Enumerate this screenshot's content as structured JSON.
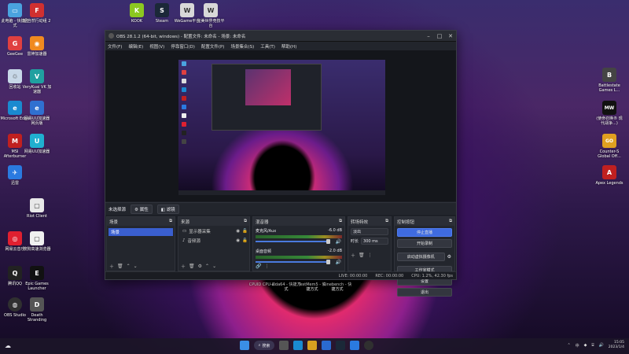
{
  "desktop": {
    "left_icons": [
      {
        "label": "此电脑 - 快捷方式",
        "color": "#4aa3df",
        "glyph": "▭"
      },
      {
        "label": "超自然行动组 2",
        "color": "#d03030",
        "glyph": "F"
      },
      {
        "label": "GeeGee",
        "color": "#e04040",
        "glyph": "G"
      },
      {
        "label": "雷神加速器",
        "color": "#f08a20",
        "glyph": "◉"
      },
      {
        "label": "回收站",
        "color": "#c8d8e8",
        "glyph": "♲"
      },
      {
        "label": "VeryKuai VK 加速器",
        "color": "#20a0a0",
        "glyph": "V"
      },
      {
        "label": "Microsoft Edge",
        "color": "#1a8ad0",
        "glyph": "e"
      },
      {
        "label": "网易UU加速器 网页版",
        "color": "#3070d0",
        "glyph": "e"
      },
      {
        "label": "MSI Afterburner",
        "color": "#c02020",
        "glyph": "M"
      },
      {
        "label": "网易UU加速器",
        "color": "#20b0d0",
        "glyph": "U"
      },
      {
        "label": "迅雷",
        "color": "#2a7ae0",
        "glyph": "✈"
      },
      {
        "label": "Riot Client",
        "color": "#e8e8e8",
        "glyph": "▢"
      },
      {
        "label": "网易云音乐",
        "color": "#e02030",
        "glyph": "◎"
      },
      {
        "label": "搜狗高速浏览器",
        "color": "#f0f0f0",
        "glyph": "▢"
      },
      {
        "label": "腾讯QQ",
        "color": "#222",
        "glyph": "Q"
      },
      {
        "label": "Epic Games Launcher",
        "color": "#111",
        "glyph": "E"
      },
      {
        "label": "OBS Studio",
        "color": "#303030",
        "glyph": "◍"
      },
      {
        "label": "Death Stranding",
        "color": "#555",
        "glyph": "D"
      }
    ],
    "top_icons": [
      {
        "label": "KOOK",
        "color": "#8cc820",
        "glyph": "K"
      },
      {
        "label": "Steam",
        "color": "#1b2838",
        "glyph": "S"
      },
      {
        "label": "WeGame平台",
        "color": "#d8d8d8",
        "glyph": "W"
      },
      {
        "label": "完美世界竞技平台",
        "color": "#d8d8d8",
        "glyph": "W"
      }
    ],
    "right_icons": [
      {
        "label": "Battlestate Games L...",
        "color": "#444",
        "glyph": "B"
      },
      {
        "label": "(使命召唤® 现代战争...)",
        "color": "#111",
        "glyph": "MW"
      },
      {
        "label": "Counter-S Global Off...",
        "color": "#e0a020",
        "glyph": "GO"
      },
      {
        "label": "Apex Legends",
        "color": "#c02020",
        "glyph": "A"
      }
    ],
    "bottom_labels": [
      {
        "label": "CPUID CPU-Z"
      },
      {
        "label": "aida64 - 快捷方式"
      },
      {
        "label": "TestMem5 - 快捷方式"
      },
      {
        "label": "Cinebench - 快捷方式"
      }
    ]
  },
  "obs": {
    "title": "OBS 28.1.2 (64-bit, windows) - 配置文件: 未命名 - 场景: 未命名",
    "menu": [
      "文件(F)",
      "编辑(E)",
      "视图(V)",
      "停靠窗口(D)",
      "配置文件(P)",
      "场景集合(S)",
      "工具(T)",
      "帮助(H)"
    ],
    "source_bar": {
      "label": "未选择源",
      "properties": "属性",
      "filters": "滤镜"
    },
    "scenes": {
      "title": "场景",
      "items": [
        "场景"
      ]
    },
    "sources": {
      "title": "来源",
      "items": [
        "显示器采集",
        "音频源"
      ]
    },
    "mixer": {
      "title": "混音器",
      "channels": [
        {
          "name": "麦克风/Aux",
          "db": "-6.0 dB"
        },
        {
          "name": "桌面音频",
          "db": "-2.0 dB"
        }
      ]
    },
    "transitions": {
      "title": "转场特效",
      "type": "淡出",
      "duration_label": "时长",
      "duration": "300 ms"
    },
    "controls": {
      "title": "控制按钮",
      "buttons": [
        "停止直播",
        "开始录制",
        "启动虚拟摄像机",
        "工作室模式",
        "设置",
        "退出"
      ]
    },
    "status": {
      "live": "LIVE: 00:00:00",
      "rec": "REC: 00:00:00",
      "cpu": "CPU: 1.2%, 42.30 fps"
    }
  },
  "taskbar": {
    "search": "搜索",
    "tray_lang": "中",
    "time": "15:05",
    "date": "2023/1/4"
  }
}
